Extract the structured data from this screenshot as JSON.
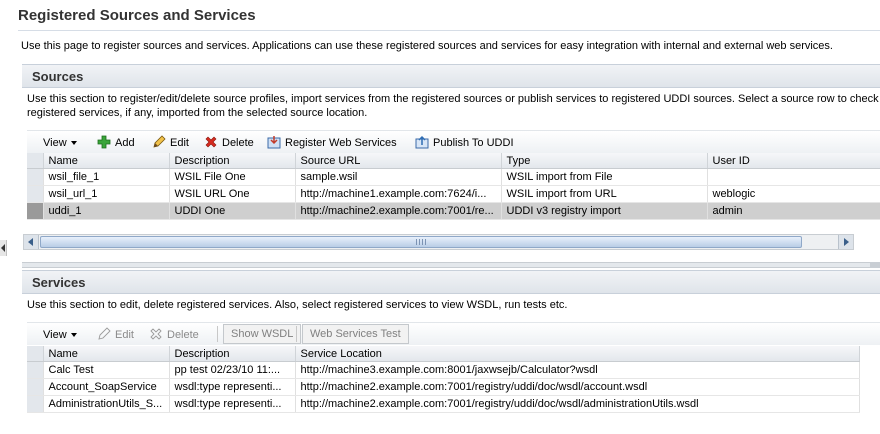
{
  "page": {
    "title": "Registered Sources and Services",
    "intro": "Use this page to register sources and services. Applications can use these registered sources and services for easy integration with internal and external web services."
  },
  "sources": {
    "title": "Sources",
    "description_line1": "Use this section to register/edit/delete source profiles, import services from the registered sources or publish services to registered UDDI sources. Select a source row to check ou",
    "description_line2": "registered services, if any, imported from the selected source location.",
    "toolbar": {
      "view": "View",
      "add": "Add",
      "edit": "Edit",
      "delete": "Delete",
      "register": "Register Web Services",
      "publish": "Publish To UDDI"
    },
    "columns": [
      "Name",
      "Description",
      "Source URL",
      "Type",
      "User ID"
    ],
    "rows": [
      {
        "name": "wsil_file_1",
        "description": "WSIL File One",
        "url": "sample.wsil",
        "type": "WSIL import from File",
        "user": ""
      },
      {
        "name": "wsil_url_1",
        "description": "WSIL URL One",
        "url": "http://machine1.example.com:7624/i...",
        "type": "WSIL import from URL",
        "user": "weblogic"
      },
      {
        "name": "uddi_1",
        "description": "UDDI One",
        "url": "http://machine2.example.com:7001/re...",
        "type": "UDDI v3 registry import",
        "user": "admin"
      }
    ],
    "selected_row": 2
  },
  "services": {
    "title": "Services",
    "description": "Use this section to edit, delete registered services. Also, select registered services to view WSDL, run tests etc.",
    "toolbar": {
      "view": "View",
      "edit": "Edit",
      "delete": "Delete",
      "show_wsdl": "Show WSDL",
      "ws_test": "Web Services Test"
    },
    "columns": [
      "Name",
      "Description",
      "Service Location"
    ],
    "rows": [
      {
        "name": "Calc Test",
        "description": "pp test 02/23/10 11:...",
        "location": "http://machine3.example.com:8001/jaxwsejb/Calculator?wsdl"
      },
      {
        "name": "Account_SoapService",
        "description": "wsdl:type representi...",
        "location": "http://machine2.example.com:7001/registry/uddi/doc/wsdl/account.wsdl"
      },
      {
        "name": "AdministrationUtils_S...",
        "description": "wsdl:type representi...",
        "location": "http://machine2.example.com:7001/registry/uddi/doc/wsdl/administrationUtils.wsdl"
      }
    ]
  },
  "icons": {
    "add": "plus-icon",
    "edit": "pencil-icon",
    "delete": "red-x-icon",
    "register": "register-icon",
    "publish": "publish-icon"
  },
  "colors": {
    "selected_row": "#cfcfcf",
    "header_gradient_top": "#f1f3f6",
    "header_gradient_bottom": "#dfe4ea"
  }
}
